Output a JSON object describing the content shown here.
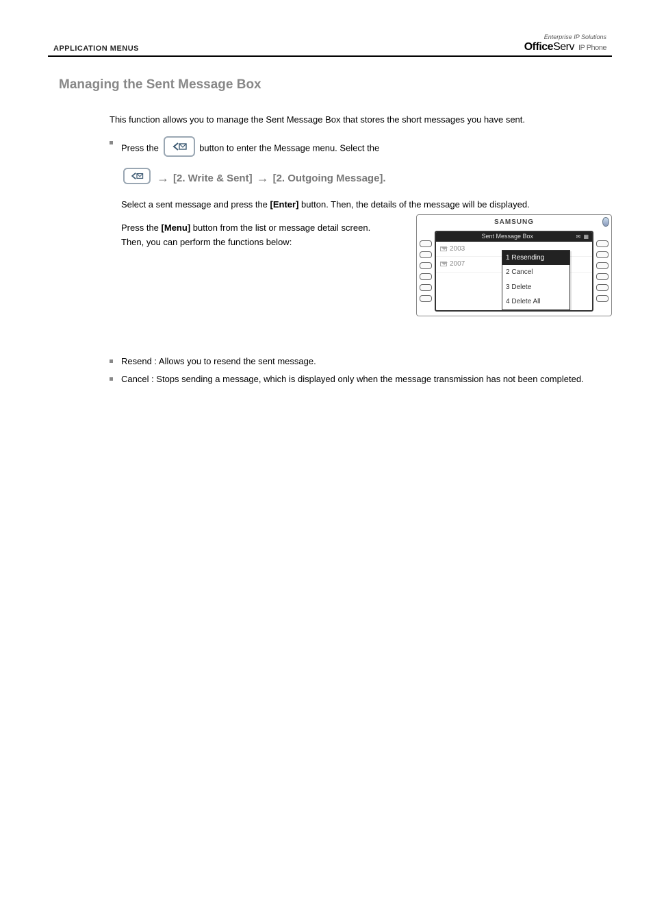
{
  "header": {
    "section": "APPLICATION MENUS",
    "brand_top": "Enterprise IP Solutions",
    "brand_bold": "Office",
    "brand_thin": "Serv",
    "brand_suffix": "IP Phone"
  },
  "title": "Managing the Sent Message Box",
  "para_intro": "This function allows you to manage the Sent Message Box that stores the short messages you have sent.",
  "steps": [
    {
      "lead": "Press the",
      "after_icon": "button to enter the Message menu. Select the",
      "nav_prefix_arrow": "→",
      "nav_text_1": "[2. Write & Sent]",
      "nav_arrow": "→",
      "nav_text_2": "[2. Outgoing Message].",
      "line2a": "Select a sent message and press the",
      "enter": "[Enter]",
      "line2b": "button. Then, the details of the message will be displayed.",
      "line3a": "Press the",
      "menu": "[Menu]",
      "line3b": "button from the list or message detail screen. Then, you can perform the functions below:"
    }
  ],
  "bullets_after": [
    "Resend : Allows you to resend the sent message.",
    "Cancel : Stops sending a message, which is displayed only when the message transmission has not been completed."
  ],
  "device": {
    "brand": "SAMSUNG",
    "screen_title": "Sent Message Box",
    "rows": [
      "2003",
      "2007"
    ],
    "popup": [
      {
        "n": "1",
        "label": "Resending",
        "sel": true
      },
      {
        "n": "2",
        "label": "Cancel",
        "sel": false
      },
      {
        "n": "3",
        "label": "Delete",
        "sel": false
      },
      {
        "n": "4",
        "label": "Delete All",
        "sel": false
      }
    ]
  }
}
